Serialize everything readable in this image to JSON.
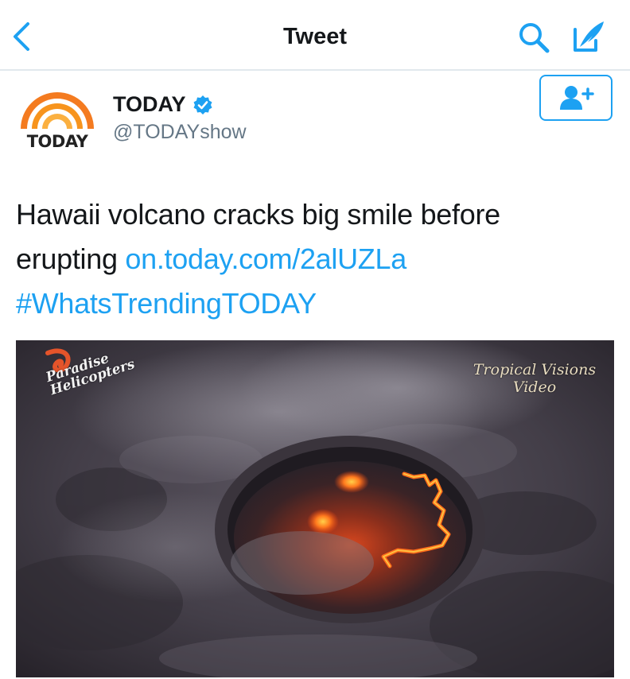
{
  "nav": {
    "title": "Tweet",
    "back_icon": "chevron-left-icon",
    "search_icon": "search-icon",
    "compose_icon": "compose-icon"
  },
  "author": {
    "display_name": "TODAY",
    "handle": "@TODAYshow",
    "verified": true,
    "avatar_logo_text": "TODAY",
    "follow_icon": "add-user-icon"
  },
  "tweet": {
    "text_plain": "Hawaii volcano cracks big smile before erupting ",
    "link": "on.today.com/2alUZLa",
    "hashtag": "#WhatsTrendingTODAY"
  },
  "media": {
    "watermark_left": [
      "Paradise",
      "Helicopters"
    ],
    "watermark_right": [
      "Tropical Visions",
      "Video"
    ]
  },
  "colors": {
    "accent": "#1da1f2",
    "text": "#14171a",
    "secondary_text": "#657786",
    "divider": "#e1e8ed",
    "logo_orange": "#f47b20"
  }
}
